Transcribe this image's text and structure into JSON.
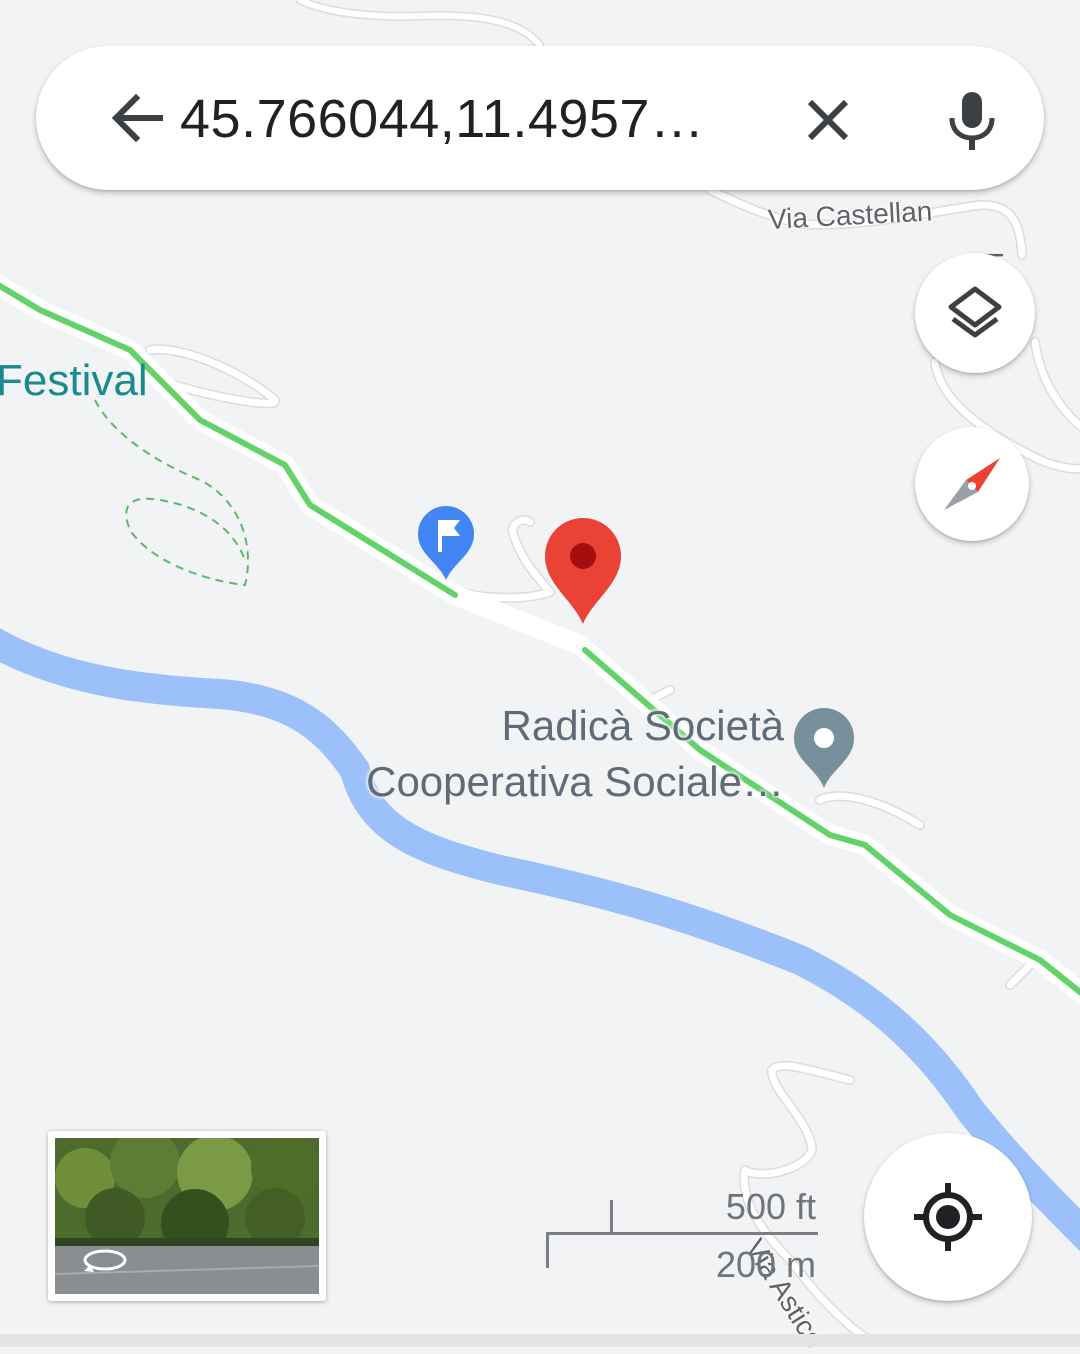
{
  "search": {
    "query": "45.766044,11.4957…",
    "back_icon": "arrow-left-icon",
    "clear_icon": "close-icon",
    "mic_icon": "microphone-icon"
  },
  "map": {
    "labels": {
      "festival": "Festival",
      "place_line1": "Radicà Società",
      "place_line2": "Cooperativa Sociale…"
    },
    "roads": {
      "castellan": "Via Castellan",
      "castellan_partial": "llan",
      "astico": "Via Astico"
    },
    "markers": {
      "dropped_pin": "red-location-pin-icon",
      "flag_pin": "blue-flag-pin-icon",
      "place_pin": "grey-place-pin-icon"
    }
  },
  "controls": {
    "layers_icon": "layers-icon",
    "compass_icon": "compass-icon",
    "locate_icon": "my-location-icon"
  },
  "scale": {
    "imperial": "500 ft",
    "metric": "200 m"
  },
  "street_view": {
    "icon": "360-rotate-icon"
  },
  "colors": {
    "map_background": "#f1f3f4",
    "road": "#ffffff",
    "traffic_green": "#63d26a",
    "river": "#9cc0f9",
    "pin_red": "#ea4335",
    "pin_blue": "#4285f4",
    "pin_grey": "#78909c",
    "festival_label": "#1b8a8f",
    "place_label": "#5f6b78"
  }
}
